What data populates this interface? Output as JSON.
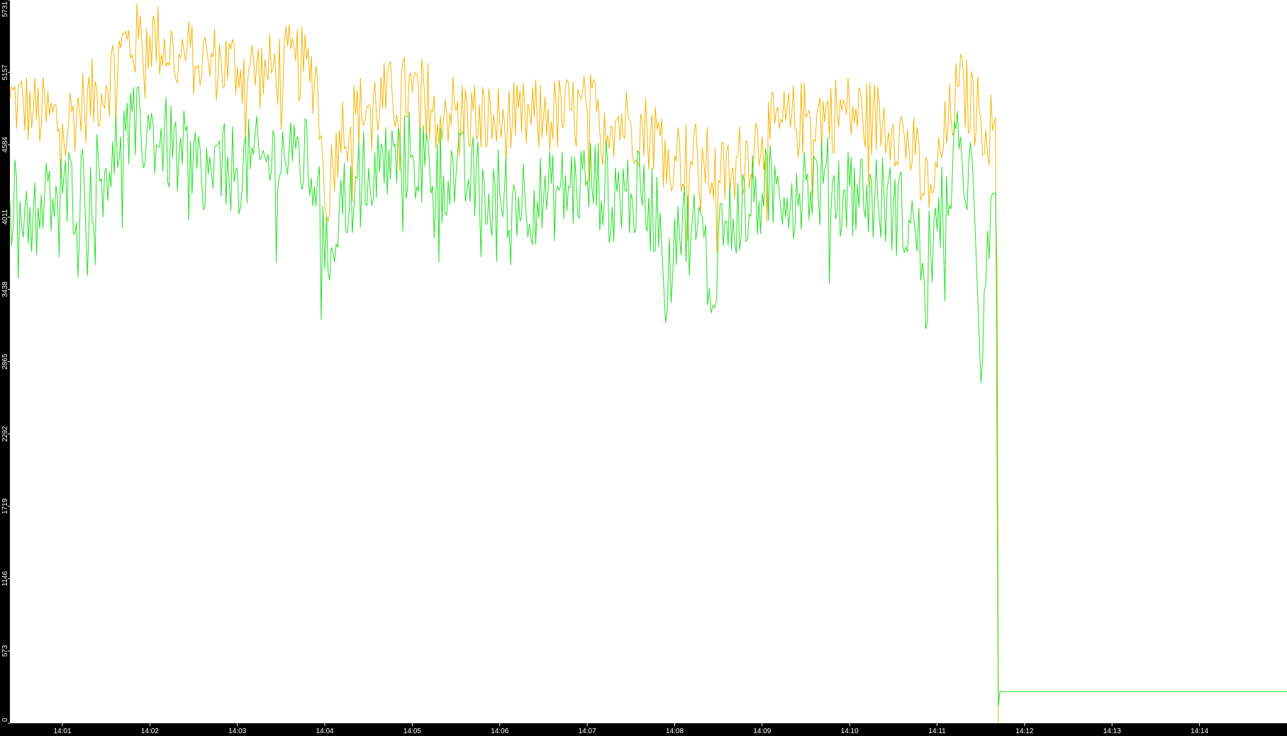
{
  "chart_data": {
    "type": "line",
    "title": "",
    "xlabel": "",
    "ylabel": "",
    "ylim": [
      0,
      5731
    ],
    "y_ticks": [
      "0",
      "573",
      "1146",
      "1719",
      "2292",
      "2865",
      "3438",
      "4011",
      "4584",
      "5157",
      "5731"
    ],
    "x_range": [
      "14:00:24",
      "14:15:00"
    ],
    "x_ticks": [
      "14:01",
      "14:02",
      "14:03",
      "14:04",
      "14:05",
      "14:06",
      "14:07",
      "14:08",
      "14:09",
      "14:10",
      "14:11",
      "14:12",
      "14:13",
      "14:14"
    ],
    "grid": false,
    "legend": "none",
    "colors": {
      "background": "#ffffff",
      "frame": "#000000",
      "text": "#ffffff",
      "series_orange": "#f5b400",
      "series_green": "#22e022"
    },
    "series": [
      {
        "color": "#f5b400",
        "x": [
          "14:00:24",
          "14:00:40",
          "14:01:00",
          "14:01:15",
          "14:01:30",
          "14:01:40",
          "14:02:00",
          "14:02:20",
          "14:02:40",
          "14:03:00",
          "14:03:20",
          "14:03:40",
          "14:03:55",
          "14:04:00",
          "14:04:10",
          "14:04:30",
          "14:05:00",
          "14:05:30",
          "14:06:00",
          "14:06:30",
          "14:07:00",
          "14:07:30",
          "14:07:50",
          "14:08:00",
          "14:08:20",
          "14:08:30",
          "14:08:40",
          "14:09:00",
          "14:09:30",
          "14:10:00",
          "14:10:30",
          "14:10:45",
          "14:10:50",
          "14:11:00",
          "14:11:15",
          "14:11:30",
          "14:11:38",
          "14:11:40",
          "14:11:41",
          "14:11:42"
        ],
        "values": [
          4950,
          4850,
          4750,
          4900,
          5050,
          5350,
          5450,
          5300,
          5250,
          5200,
          5150,
          5250,
          5100,
          4100,
          4700,
          4900,
          5000,
          4850,
          4750,
          4800,
          4850,
          4750,
          4650,
          4500,
          4450,
          4300,
          4400,
          4650,
          4800,
          4850,
          4750,
          4500,
          4200,
          4400,
          5050,
          4800,
          4700,
          4800,
          2100,
          0
        ]
      },
      {
        "color": "#22e022",
        "x": [
          "14:00:24",
          "14:00:40",
          "14:01:00",
          "14:01:15",
          "14:01:30",
          "14:01:40",
          "14:02:00",
          "14:02:20",
          "14:02:40",
          "14:03:00",
          "14:03:20",
          "14:03:40",
          "14:03:55",
          "14:04:00",
          "14:04:10",
          "14:04:30",
          "14:05:00",
          "14:05:30",
          "14:06:00",
          "14:06:30",
          "14:07:00",
          "14:07:30",
          "14:07:50",
          "14:07:55",
          "14:08:00",
          "14:08:20",
          "14:08:25",
          "14:08:30",
          "14:08:40",
          "14:09:00",
          "14:09:30",
          "14:10:00",
          "14:10:30",
          "14:10:45",
          "14:10:50",
          "14:11:00",
          "14:11:15",
          "14:11:25",
          "14:11:30",
          "14:11:38",
          "14:11:40",
          "14:11:41",
          "14:11:42",
          "14:11:43",
          "14:12:00",
          "14:13:00",
          "14:14:00",
          "14:15:00"
        ],
        "values": [
          4150,
          4050,
          4200,
          4250,
          4400,
          4650,
          4700,
          4500,
          4350,
          4400,
          4450,
          4550,
          4300,
          3600,
          4100,
          4400,
          4500,
          4350,
          4200,
          4150,
          4300,
          4200,
          4050,
          3300,
          4000,
          3850,
          3250,
          3900,
          4000,
          4200,
          4300,
          4250,
          4100,
          3900,
          3650,
          3900,
          4550,
          4250,
          2700,
          4200,
          4200,
          3600,
          130,
          250,
          250,
          250,
          250,
          250
        ]
      }
    ]
  }
}
